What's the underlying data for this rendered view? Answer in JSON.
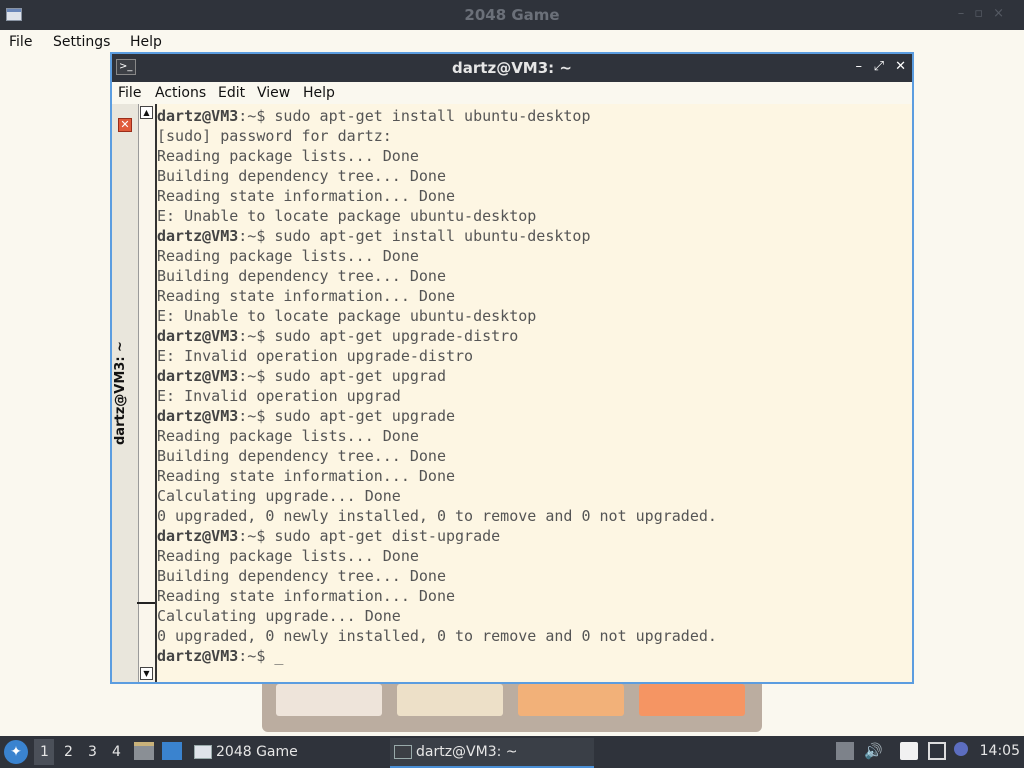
{
  "game_window": {
    "title": "2048 Game",
    "menu": [
      "File",
      "Settings",
      "Help"
    ],
    "tile_colors": [
      "#eee4da",
      "#ede0c8",
      "#f2b179",
      "#f59563"
    ]
  },
  "terminal": {
    "title": "dartz@VM3: ~",
    "menu": [
      "File",
      "Actions",
      "Edit",
      "View",
      "Help"
    ],
    "tab_label": "dartz@VM3: ~",
    "lines": [
      {
        "prompt": "dartz@VM3",
        "rest": ":~$ sudo apt-get install ubuntu-desktop"
      },
      {
        "prompt": "",
        "rest": "[sudo] password for dartz:"
      },
      {
        "prompt": "",
        "rest": "Reading package lists... Done"
      },
      {
        "prompt": "",
        "rest": "Building dependency tree... Done"
      },
      {
        "prompt": "",
        "rest": "Reading state information... Done"
      },
      {
        "prompt": "",
        "rest": "E: Unable to locate package ubuntu-desktop"
      },
      {
        "prompt": "dartz@VM3",
        "rest": ":~$ sudo apt-get install ubuntu-desktop"
      },
      {
        "prompt": "",
        "rest": "Reading package lists... Done"
      },
      {
        "prompt": "",
        "rest": "Building dependency tree... Done"
      },
      {
        "prompt": "",
        "rest": "Reading state information... Done"
      },
      {
        "prompt": "",
        "rest": "E: Unable to locate package ubuntu-desktop"
      },
      {
        "prompt": "dartz@VM3",
        "rest": ":~$ sudo apt-get upgrade-distro"
      },
      {
        "prompt": "",
        "rest": "E: Invalid operation upgrade-distro"
      },
      {
        "prompt": "dartz@VM3",
        "rest": ":~$ sudo apt-get upgrad"
      },
      {
        "prompt": "",
        "rest": "E: Invalid operation upgrad"
      },
      {
        "prompt": "dartz@VM3",
        "rest": ":~$ sudo apt-get upgrade"
      },
      {
        "prompt": "",
        "rest": "Reading package lists... Done"
      },
      {
        "prompt": "",
        "rest": "Building dependency tree... Done"
      },
      {
        "prompt": "",
        "rest": "Reading state information... Done"
      },
      {
        "prompt": "",
        "rest": "Calculating upgrade... Done"
      },
      {
        "prompt": "",
        "rest": "0 upgraded, 0 newly installed, 0 to remove and 0 not upgraded."
      },
      {
        "prompt": "dartz@VM3",
        "rest": ":~$ sudo apt-get dist-upgrade"
      },
      {
        "prompt": "",
        "rest": "Reading package lists... Done"
      },
      {
        "prompt": "",
        "rest": "Building dependency tree... Done"
      },
      {
        "prompt": "",
        "rest": "Reading state information... Done"
      },
      {
        "prompt": "",
        "rest": "Calculating upgrade... Done"
      },
      {
        "prompt": "",
        "rest": "0 upgraded, 0 newly installed, 0 to remove and 0 not upgraded."
      },
      {
        "prompt": "dartz@VM3",
        "rest": ":~$ _"
      }
    ]
  },
  "taskbar": {
    "workspaces": [
      "1",
      "2",
      "3",
      "4"
    ],
    "active_workspace": "1",
    "tasks": [
      {
        "label": "2048 Game",
        "icon": "window-icon"
      },
      {
        "label": "dartz@VM3: ~",
        "icon": "terminal-icon"
      }
    ],
    "clock": "14:05"
  },
  "colors": {
    "accent": "#4a8fd6",
    "panel": "#2f333b",
    "terminal_bg": "#fdf6e3"
  }
}
